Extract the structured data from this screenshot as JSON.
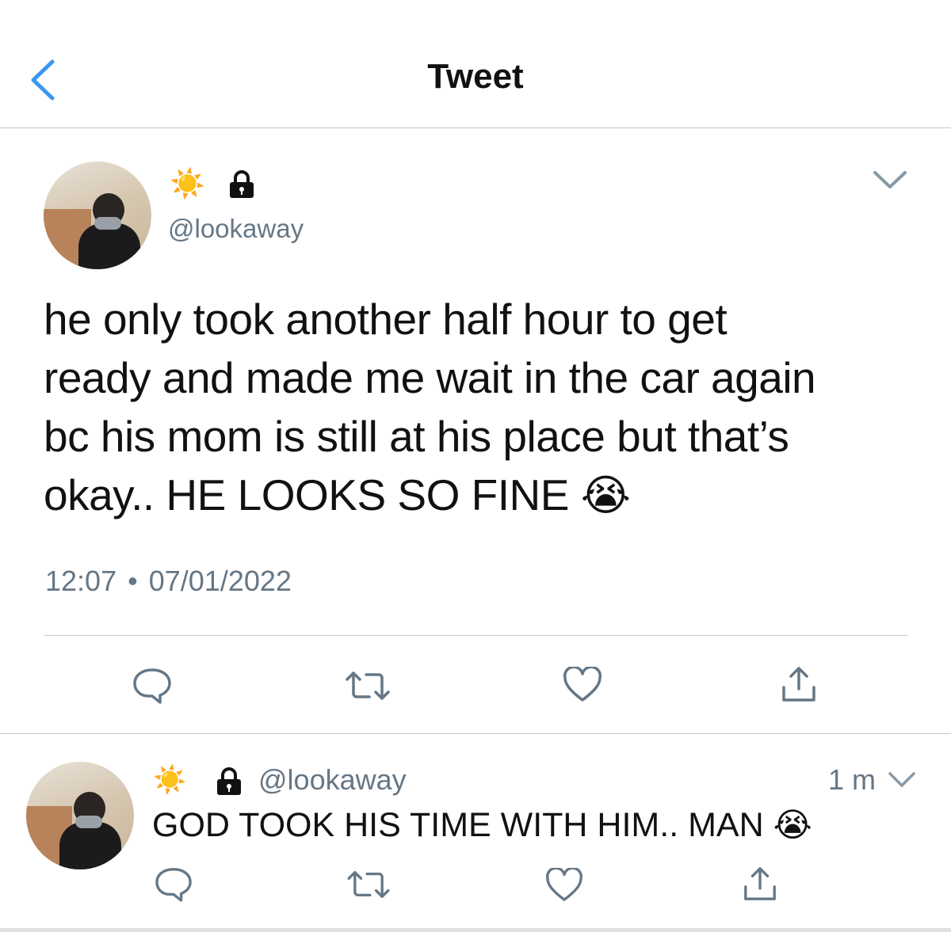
{
  "header": {
    "title": "Tweet"
  },
  "main_tweet": {
    "name_emoji": "☀️",
    "handle": "@lookaway",
    "text_lines": [
      "he only took another half hour to get",
      "ready and made me wait in the car again",
      "bc his mom is still at his place but that’s",
      "okay.. HE LOOKS SO FINE"
    ],
    "emoji": "😭",
    "time": "12:07",
    "dot": "•",
    "date": "07/01/2022"
  },
  "reply": {
    "name_emoji": "☀️",
    "handle": "@lookaway",
    "age": "1 m",
    "text": "GOD TOOK HIS TIME WITH HIM.. MAN",
    "emoji": "😭"
  },
  "colors": {
    "accent": "#1d9bf0",
    "secondary_text": "#657786",
    "icon_gray": "#657786",
    "divider": "#c8c8cc"
  },
  "icons": [
    "back-chevron-icon",
    "lock-icon",
    "chevron-down-icon",
    "reply-icon",
    "retweet-icon",
    "like-icon",
    "share-icon"
  ]
}
